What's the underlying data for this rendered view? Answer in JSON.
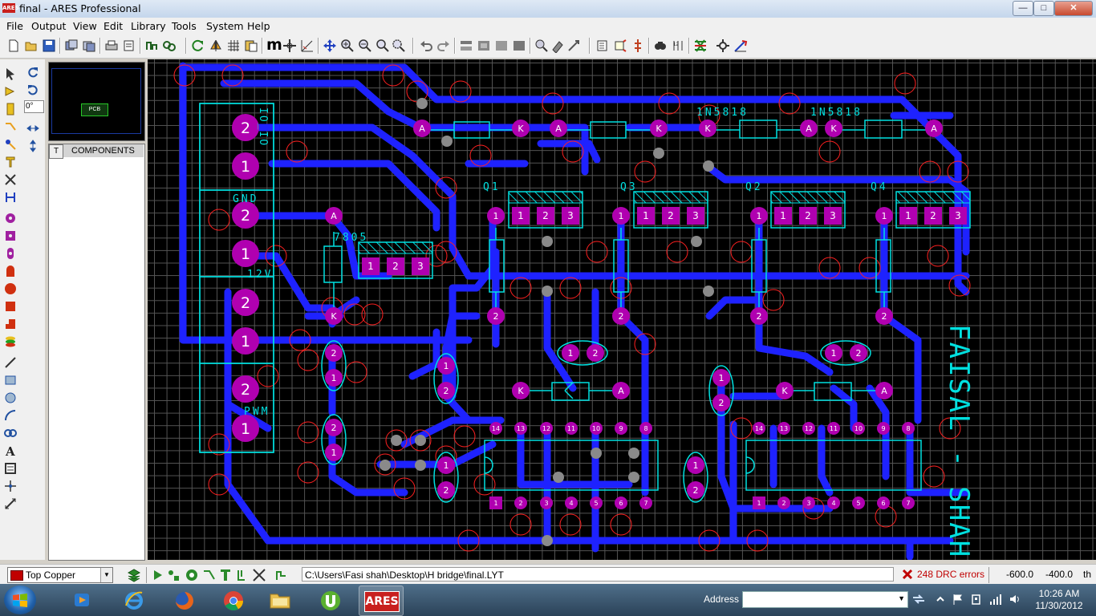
{
  "window": {
    "title": "final - ARES Professional",
    "icon_label": "ARES",
    "controls": {
      "minimize": "—",
      "maximize": "□",
      "close": "✕"
    }
  },
  "menu": [
    "File",
    "Output",
    "View",
    "Edit",
    "Library",
    "Tools",
    "System",
    "Help"
  ],
  "toolbar": {
    "icons": [
      "new-icon",
      "open-icon",
      "save-icon",
      "import-icon",
      "export-icon",
      "print-icon",
      "print-setup-icon",
      "netlist-icon",
      "netlist2-icon",
      "refresh-icon",
      "flip-icon",
      "grid-icon",
      "layers-icon",
      "m-icon",
      "origin-icon",
      "snap-icon",
      "pan-icon",
      "zoom-in-icon",
      "zoom-out-icon",
      "zoom-all-icon",
      "zoom-area-icon",
      "undo-icon",
      "redo-icon",
      "block-copy-icon",
      "block-move-icon",
      "block-rotate-icon",
      "block-delete-icon",
      "pick-icon",
      "library-icon",
      "package-icon",
      "tag-icon",
      "bus-icon",
      "search-icon",
      "autorouter-icon",
      "design-explorer-icon",
      "ratsnest-icon",
      "autoplace-icon",
      "connectivity-icon"
    ],
    "m_label": "m"
  },
  "left_tools": [
    "select-icon",
    "component-icon",
    "package-icon",
    "track-icon",
    "via-icon",
    "zone-icon",
    "ratsnest-icon",
    "connectivity-icon",
    "round-pad-icon",
    "square-pad-icon",
    "dil-pad-icon",
    "edge-pad-icon",
    "circle-pad-icon",
    "rect-pad-icon",
    "polygon-pad-icon",
    "padstack-icon",
    "line-icon",
    "box-icon",
    "circle-icon",
    "arc-icon",
    "path-icon",
    "text-icon",
    "symbol-icon",
    "marker-icon",
    "dimension-icon"
  ],
  "rotation": {
    "value": "0°"
  },
  "overview": {
    "board_label": "PCB"
  },
  "selector": {
    "tab": "T",
    "header": "COMPONENTS",
    "items": []
  },
  "board": {
    "labels": {
      "d1": "1N5818",
      "d2": "1N5818",
      "q1": "Q1",
      "q3": "Q3",
      "q2": "Q2",
      "q4": "Q4",
      "reg": "7805",
      "gnd": "GND",
      "v12": "12V",
      "pwm": "PWM",
      "silk_right": "FAISAL - SHAH",
      "conn_top": "IO_IO"
    },
    "pad_numbers": {
      "one": "1",
      "two": "2",
      "three": "3",
      "a": "A",
      "k": "K"
    },
    "ic_pins_top": [
      "14",
      "13",
      "12",
      "11",
      "10",
      "9",
      "8"
    ],
    "ic_pins_bottom": [
      "1",
      "2",
      "3",
      "4",
      "5",
      "6",
      "7"
    ],
    "colors": {
      "copper": "#2020ff",
      "pad": "#b000b0",
      "silk": "#00e0e0",
      "drc": "#ff2020",
      "via": "#808080",
      "grid": "#555555"
    }
  },
  "status": {
    "layer": "Top Copper",
    "path": "C:\\Users\\Fasi shah\\Desktop\\H bridge\\final.LYT",
    "drc_errors": "248 DRC errors",
    "x": "-600.0",
    "y": "-400.0",
    "unit": "th"
  },
  "taskbar": {
    "apps": [
      "start-button",
      "media-icon",
      "internet-explorer-icon",
      "firefox-icon",
      "chrome-icon",
      "explorer-icon",
      "utorrent-icon",
      "ares-icon"
    ],
    "ares_label": "ARES",
    "address_label": "Address",
    "address_value": "",
    "time": "10:26 AM",
    "date": "11/30/2012"
  }
}
